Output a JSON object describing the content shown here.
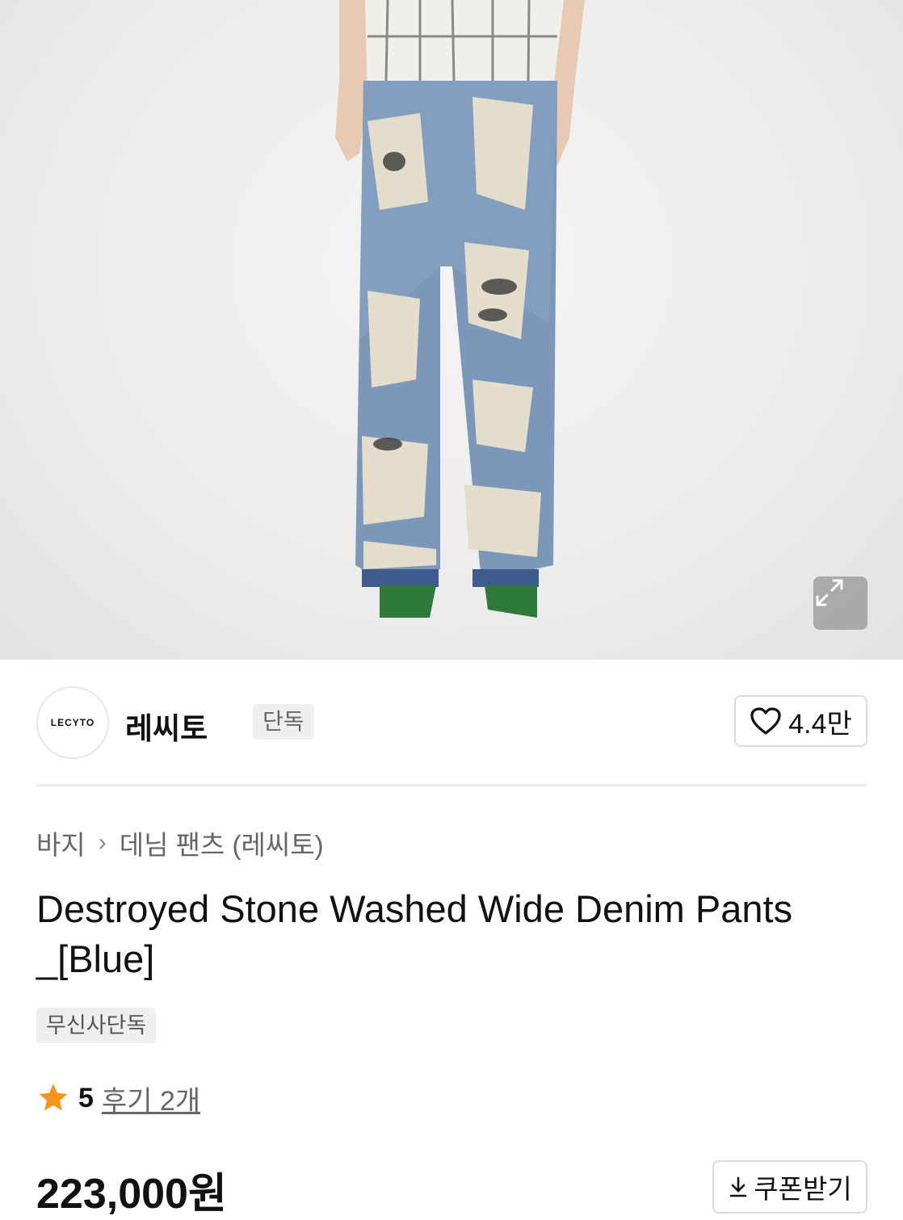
{
  "brand": {
    "logo_text": "LECYTO",
    "name": "레씨토",
    "badge": "단독"
  },
  "like": {
    "count": "4.4만"
  },
  "breadcrumb": {
    "category": "바지",
    "separator": "›",
    "subcategory": "데님 팬츠 (레씨토)"
  },
  "product": {
    "title": "Destroyed Stone Washed Wide Denim Pants _[Blue]",
    "tag": "무신사단독",
    "rating": "5",
    "review_link": "후기 2개",
    "price": "223,000원"
  },
  "coupon": {
    "label": "쿠폰받기"
  },
  "colors": {
    "star": "#F7941D",
    "text": "#111111",
    "muted": "#666666",
    "chip_bg": "#EFEFEF"
  }
}
